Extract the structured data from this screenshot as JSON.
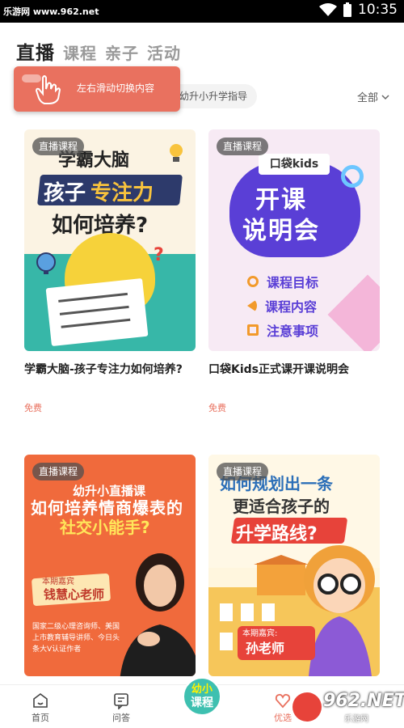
{
  "status_bar": {
    "watermark": "乐游网 www.962.net",
    "time": "10:35"
  },
  "tabs": [
    {
      "label": "直播",
      "active": true
    },
    {
      "label": "课程",
      "active": false
    },
    {
      "label": "亲子",
      "active": false
    },
    {
      "label": "活动",
      "active": false
    }
  ],
  "tooltip": {
    "text": "左右滑动切换内容"
  },
  "filter": {
    "chip": "幼升小升学指导",
    "all": "全部"
  },
  "badge_label": "直播课程",
  "cards": [
    {
      "title": "学霸大脑-孩子专注力如何培养?",
      "price": "免费",
      "thumb": {
        "line1": "学霸大脑",
        "line2a": "孩子",
        "line2b": "专注力",
        "line3": "如何培养?"
      }
    },
    {
      "title": "口袋Kids正式课开课说明会",
      "price": "免费",
      "thumb": {
        "brand": "口袋kids",
        "big1": "开课",
        "big2": "说明会",
        "items": [
          "课程目标",
          "课程内容",
          "注意事项"
        ]
      }
    },
    {
      "title": "",
      "price": "",
      "thumb": {
        "head1": "幼升小直播课",
        "head2": "如何培养情商爆表的",
        "head3": "社交小能手?",
        "host": "本期嘉宾",
        "name": "钱慧心老师",
        "desc": "国家二级心理咨询师、美国上市教育辅导讲师、今日头条大V认证作者"
      }
    },
    {
      "title": "",
      "price": "",
      "thumb": {
        "l1": "如何规划出一条",
        "l2": "更适合孩子的",
        "l3": "升学路线?",
        "host": "本期嘉宾:",
        "name": "孙老师"
      }
    }
  ],
  "bottom_nav": [
    {
      "label": "首页",
      "icon": "home-icon"
    },
    {
      "label": "问答",
      "icon": "qa-icon"
    },
    {
      "label_top": "幼小",
      "label_bottom": "课程",
      "icon": "center-course-icon"
    },
    {
      "label": "优选",
      "icon": "heart-icon"
    }
  ],
  "watermark": {
    "text": "962.NET",
    "sub": "乐游网"
  },
  "colors": {
    "accent": "#e9715f",
    "teal": "#3ec0b0",
    "purple": "#5a3fd6"
  }
}
